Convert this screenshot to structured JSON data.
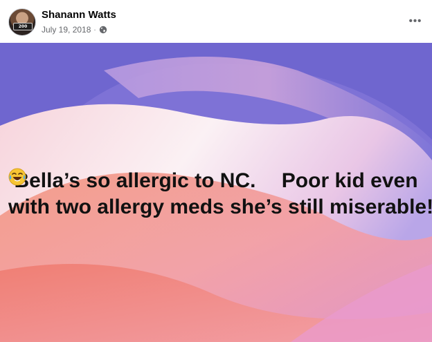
{
  "post": {
    "author": "Shanann Watts",
    "date": "July 19, 2018",
    "separator": "·",
    "privacy_icon": "globe-icon",
    "more_label": "•••",
    "avatar_sign_text": "200",
    "text_line1_before": "Bella’s so allergic to NC. ",
    "emoji": "laughing-tears-emoji",
    "text_line1_after": "Poor kid even",
    "text_line2": "with two allergy meds she’s still miserable!",
    "background_colors": {
      "top": "#6e63c9",
      "middle": "#f3e6f2",
      "bottom": "#f3857c"
    },
    "text_color": "#111111"
  }
}
